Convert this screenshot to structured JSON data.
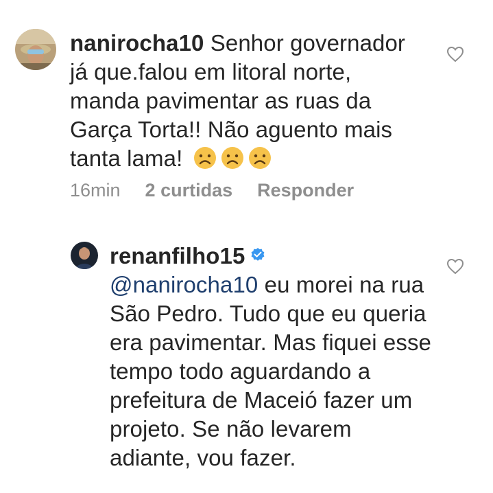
{
  "comments": [
    {
      "username": "nanirocha10",
      "text": " Senhor governador já que.falou em litoral norte, manda pavimentar as ruas da Garça Torta!! Não aguento mais tanta lama!",
      "emoji": "frowning-face",
      "emoji_count": 3,
      "time": "16min",
      "likes": "2 curtidas",
      "reply_label": "Responder"
    },
    {
      "username": "renanfilho15",
      "verified": true,
      "mention": "@nanirocha10",
      "text": " eu morei na rua São Pedro. Tudo que eu queria era pavimentar. Mas fiquei esse tempo todo aguardando a prefeitura de Maceió fazer um projeto. Se não levarem adiante, vou fazer."
    }
  ],
  "colors": {
    "text": "#262626",
    "meta": "#8e8e8e",
    "mention": "#1f3f6e",
    "verified": "#3897f0",
    "emoji": "#f6c24a"
  }
}
